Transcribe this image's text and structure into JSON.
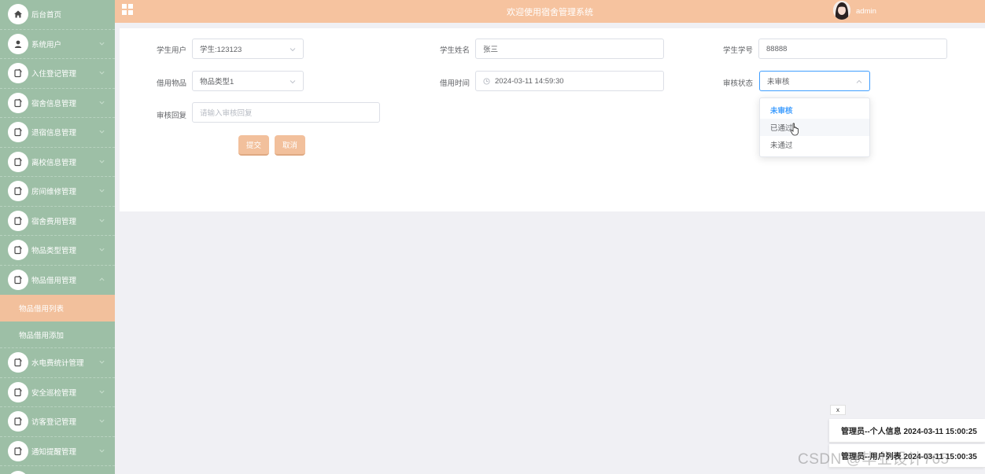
{
  "header": {
    "title": "欢迎使用宿舍管理系统",
    "user": "admin"
  },
  "sidebar": {
    "items": [
      {
        "label": "后台首页",
        "icon": "home-icon"
      },
      {
        "label": "系统用户",
        "icon": "user-icon"
      },
      {
        "label": "入住登记管理",
        "icon": "doc-icon"
      },
      {
        "label": "宿舍信息管理",
        "icon": "doc-icon"
      },
      {
        "label": "退宿信息管理",
        "icon": "doc-icon"
      },
      {
        "label": "离校信息管理",
        "icon": "doc-icon"
      },
      {
        "label": "房间维修管理",
        "icon": "doc-icon"
      },
      {
        "label": "宿舍费用管理",
        "icon": "doc-icon"
      },
      {
        "label": "物品类型管理",
        "icon": "doc-icon"
      },
      {
        "label": "物品借用管理",
        "icon": "doc-icon"
      }
    ],
    "sub_items": [
      {
        "label": "物品借用列表"
      },
      {
        "label": "物品借用添加"
      }
    ],
    "items_after": [
      {
        "label": "水电费统计管理",
        "icon": "doc-icon"
      },
      {
        "label": "安全巡检管理",
        "icon": "doc-icon"
      },
      {
        "label": "访客登记管理",
        "icon": "doc-icon"
      },
      {
        "label": "通知提醒管理",
        "icon": "doc-icon"
      }
    ]
  },
  "form": {
    "student_user_label": "学生用户",
    "student_user_value": "学生:123123",
    "student_name_label": "学生姓名",
    "student_name_value": "张三",
    "student_no_label": "学生学号",
    "student_no_value": "88888",
    "item_label": "借用物品",
    "item_value": "物品类型1",
    "time_label": "借用时间",
    "time_value": "2024-03-11 14:59:30",
    "status_label": "审核状态",
    "status_value": "未审核",
    "reply_label": "审核回复",
    "reply_placeholder": "请输入审核回复",
    "submit_label": "提交",
    "cancel_label": "取消"
  },
  "dropdown": {
    "options": [
      "未审核",
      "已通过",
      "未通过"
    ],
    "selected": "未审核"
  },
  "notifications": {
    "close_label": "x",
    "items": [
      "管理员--个人信息 2024-03-11 15:00:25",
      "管理员--用户列表 2024-03-11 15:00:35"
    ]
  },
  "watermark": "CSDN @毕业设计765",
  "colors": {
    "sidebar_bg": "#9dbfa6",
    "header_bg": "#f6c39f",
    "accent": "#f2c09c",
    "focus": "#409eff"
  }
}
